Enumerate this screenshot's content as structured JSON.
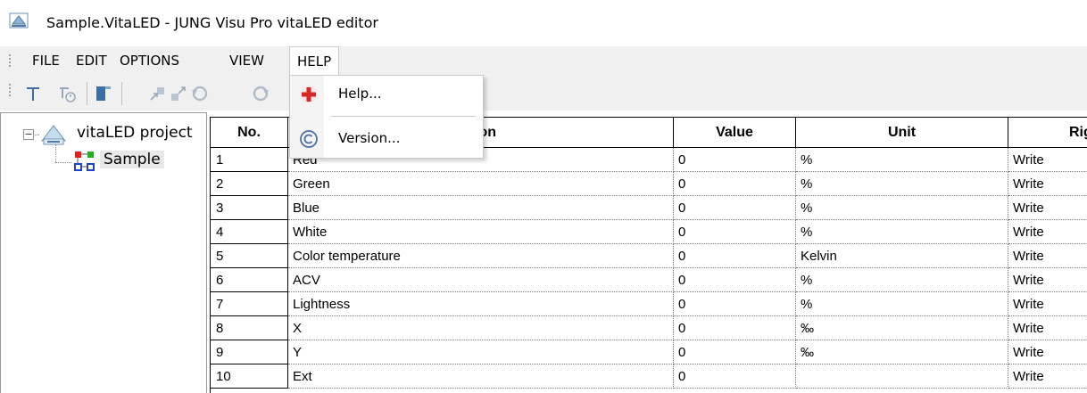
{
  "window": {
    "title": "Sample.VitaLED - JUNG Visu Pro vitaLED editor",
    "app_icon": "vitaled-app-icon"
  },
  "menubar": {
    "items": [
      {
        "label": "FILE"
      },
      {
        "label": "EDIT"
      },
      {
        "label": "OPTIONS"
      },
      {
        "label": "VIEW"
      },
      {
        "label": "HELP",
        "active": true
      }
    ]
  },
  "toolbar": {
    "icons": [
      "align-top-icon",
      "timer-icon",
      "door-icon",
      "export-icon",
      "import-icon",
      "undo-icon",
      "redo-icon"
    ]
  },
  "help_menu": {
    "items": [
      {
        "label": "Help...",
        "icon": "red-cross-help-icon"
      },
      {
        "label": "Version...",
        "icon": "copyright-icon"
      }
    ]
  },
  "tree": {
    "root": {
      "label": "vitaLED project",
      "expanded": true,
      "icon": "project-icon"
    },
    "children": [
      {
        "label": "Sample",
        "selected": true,
        "icon": "network-nodes-icon"
      }
    ]
  },
  "grid": {
    "columns": [
      "No.",
      "nation",
      "Value",
      "Unit",
      "Rig"
    ],
    "rows": [
      {
        "no": "1",
        "name": "Red",
        "value": "0",
        "unit": "%",
        "right": "Write"
      },
      {
        "no": "2",
        "name": "Green",
        "value": "0",
        "unit": "%",
        "right": "Write"
      },
      {
        "no": "3",
        "name": "Blue",
        "value": "0",
        "unit": "%",
        "right": "Write"
      },
      {
        "no": "4",
        "name": "White",
        "value": "0",
        "unit": "%",
        "right": "Write"
      },
      {
        "no": "5",
        "name": "Color temperature",
        "value": "0",
        "unit": "Kelvin",
        "right": "Write"
      },
      {
        "no": "6",
        "name": "ACV",
        "value": "0",
        "unit": "%",
        "right": "Write"
      },
      {
        "no": "7",
        "name": "Lightness",
        "value": "0",
        "unit": "%",
        "right": "Write"
      },
      {
        "no": "8",
        "name": "X",
        "value": "0",
        "unit": "‰",
        "right": "Write"
      },
      {
        "no": "9",
        "name": "Y",
        "value": "0",
        "unit": "‰",
        "right": "Write"
      },
      {
        "no": "10",
        "name": "Ext",
        "value": "0",
        "unit": "",
        "right": "Write"
      }
    ]
  },
  "colors": {
    "menu_bg": "#f0f0f0",
    "help_icon_red": "#d92626",
    "selection_bg": "#e8e8e8"
  }
}
